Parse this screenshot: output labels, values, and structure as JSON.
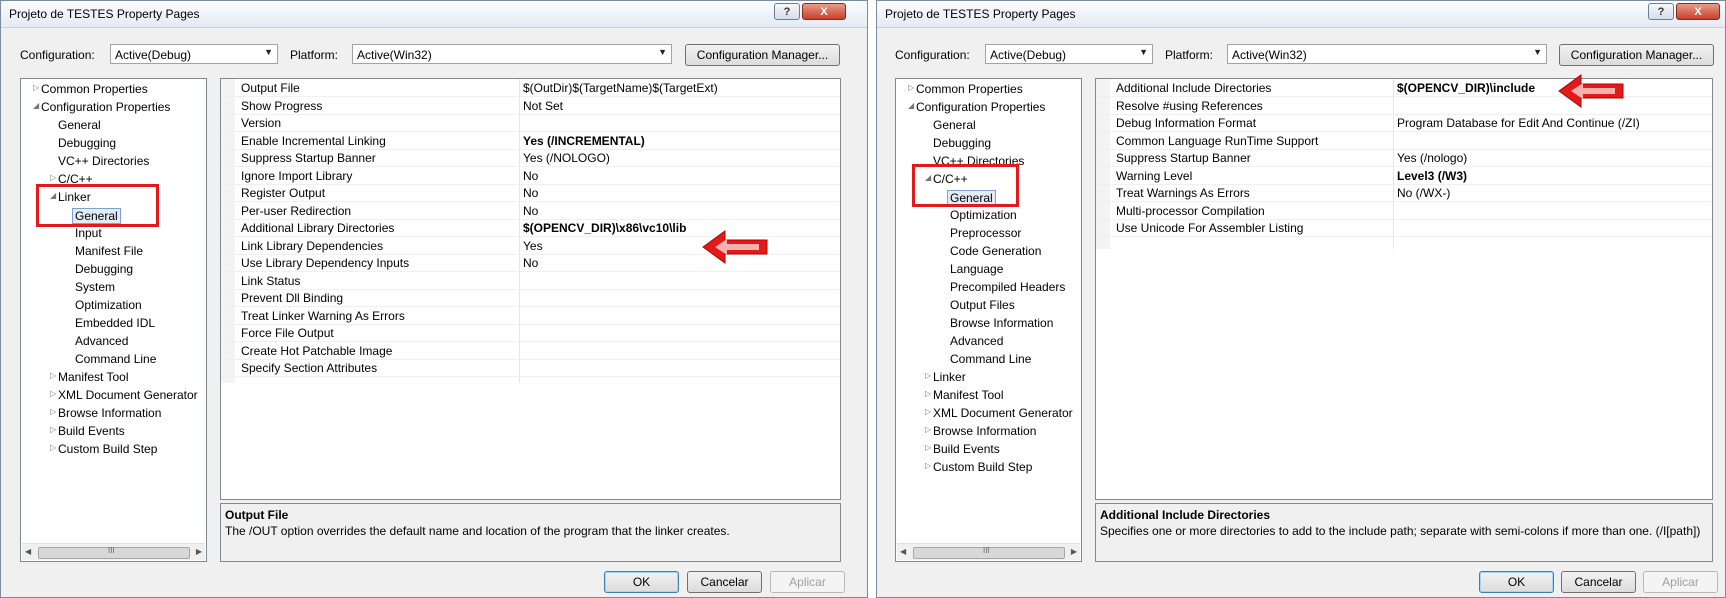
{
  "dialog_left": {
    "title": "Projeto de TESTES Property Pages",
    "help_glyph": "?",
    "close_glyph": "X",
    "config_label": "Configuration:",
    "config_value": "Active(Debug)",
    "platform_label": "Platform:",
    "platform_value": "Active(Win32)",
    "config_manager": "Configuration Manager...",
    "tree": [
      {
        "label": "Common Properties",
        "toggle": "▷"
      },
      {
        "label": "Configuration Properties",
        "toggle": "◢"
      },
      {
        "label": "General",
        "toggle": ""
      },
      {
        "label": "Debugging",
        "toggle": ""
      },
      {
        "label": "VC++ Directories",
        "toggle": ""
      },
      {
        "label": "C/C++",
        "toggle": "▷"
      },
      {
        "label": "Linker",
        "toggle": "◢"
      },
      {
        "label": "General",
        "toggle": ""
      },
      {
        "label": "Input",
        "toggle": ""
      },
      {
        "label": "Manifest File",
        "toggle": ""
      },
      {
        "label": "Debugging",
        "toggle": ""
      },
      {
        "label": "System",
        "toggle": ""
      },
      {
        "label": "Optimization",
        "toggle": ""
      },
      {
        "label": "Embedded IDL",
        "toggle": ""
      },
      {
        "label": "Advanced",
        "toggle": ""
      },
      {
        "label": "Command Line",
        "toggle": ""
      },
      {
        "label": "Manifest Tool",
        "toggle": "▷"
      },
      {
        "label": "XML Document Generator",
        "toggle": "▷"
      },
      {
        "label": "Browse Information",
        "toggle": "▷"
      },
      {
        "label": "Build Events",
        "toggle": "▷"
      },
      {
        "label": "Custom Build Step",
        "toggle": "▷"
      }
    ],
    "scroll_left": "◀",
    "scroll_right": "▶",
    "scroll_grip": "III",
    "props": [
      {
        "name": "Output File",
        "value": "$(OutDir)$(TargetName)$(TargetExt)"
      },
      {
        "name": "Show Progress",
        "value": "Not Set"
      },
      {
        "name": "Version",
        "value": ""
      },
      {
        "name": "Enable Incremental Linking",
        "value": "Yes (/INCREMENTAL)"
      },
      {
        "name": "Suppress Startup Banner",
        "value": "Yes (/NOLOGO)"
      },
      {
        "name": "Ignore Import Library",
        "value": "No"
      },
      {
        "name": "Register Output",
        "value": "No"
      },
      {
        "name": "Per-user Redirection",
        "value": "No"
      },
      {
        "name": "Additional Library Directories",
        "value": "$(OPENCV_DIR)\\x86\\vc10\\lib"
      },
      {
        "name": "Link Library Dependencies",
        "value": "Yes"
      },
      {
        "name": "Use Library Dependency Inputs",
        "value": "No"
      },
      {
        "name": "Link Status",
        "value": ""
      },
      {
        "name": "Prevent Dll Binding",
        "value": ""
      },
      {
        "name": "Treat Linker Warning As Errors",
        "value": ""
      },
      {
        "name": "Force File Output",
        "value": ""
      },
      {
        "name": "Create Hot Patchable Image",
        "value": ""
      },
      {
        "name": "Specify Section Attributes",
        "value": ""
      }
    ],
    "desc_title": "Output File",
    "desc_text": "The /OUT option overrides the default name and location of the program that the linker creates.",
    "ok": "OK",
    "cancel": "Cancelar",
    "apply": "Aplicar"
  },
  "dialog_right": {
    "title": "Projeto de TESTES Property Pages",
    "help_glyph": "?",
    "close_glyph": "X",
    "config_label": "Configuration:",
    "config_value": "Active(Debug)",
    "platform_label": "Platform:",
    "platform_value": "Active(Win32)",
    "config_manager": "Configuration Manager...",
    "tree": [
      {
        "label": "Common Properties",
        "toggle": "▷"
      },
      {
        "label": "Configuration Properties",
        "toggle": "◢"
      },
      {
        "label": "General",
        "toggle": ""
      },
      {
        "label": "Debugging",
        "toggle": ""
      },
      {
        "label": "VC++ Directories",
        "toggle": ""
      },
      {
        "label": "C/C++",
        "toggle": "◢"
      },
      {
        "label": "General",
        "toggle": ""
      },
      {
        "label": "Optimization",
        "toggle": ""
      },
      {
        "label": "Preprocessor",
        "toggle": ""
      },
      {
        "label": "Code Generation",
        "toggle": ""
      },
      {
        "label": "Language",
        "toggle": ""
      },
      {
        "label": "Precompiled Headers",
        "toggle": ""
      },
      {
        "label": "Output Files",
        "toggle": ""
      },
      {
        "label": "Browse Information",
        "toggle": ""
      },
      {
        "label": "Advanced",
        "toggle": ""
      },
      {
        "label": "Command Line",
        "toggle": ""
      },
      {
        "label": "Linker",
        "toggle": "▷"
      },
      {
        "label": "Manifest Tool",
        "toggle": "▷"
      },
      {
        "label": "XML Document Generator",
        "toggle": "▷"
      },
      {
        "label": "Browse Information",
        "toggle": "▷"
      },
      {
        "label": "Build Events",
        "toggle": "▷"
      },
      {
        "label": "Custom Build Step",
        "toggle": "▷"
      }
    ],
    "scroll_left": "◀",
    "scroll_right": "▶",
    "scroll_grip": "III",
    "props": [
      {
        "name": "Additional Include Directories",
        "value": "$(OPENCV_DIR)\\include"
      },
      {
        "name": "Resolve #using References",
        "value": ""
      },
      {
        "name": "Debug Information Format",
        "value": "Program Database for Edit And Continue (/ZI)"
      },
      {
        "name": "Common Language RunTime Support",
        "value": ""
      },
      {
        "name": "Suppress Startup Banner",
        "value": "Yes (/nologo)"
      },
      {
        "name": "Warning Level",
        "value": "Level3 (/W3)"
      },
      {
        "name": "Treat Warnings As Errors",
        "value": "No (/WX-)"
      },
      {
        "name": "Multi-processor Compilation",
        "value": ""
      },
      {
        "name": "Use Unicode For Assembler Listing",
        "value": ""
      }
    ],
    "desc_title": "Additional Include Directories",
    "desc_text": "Specifies one or more directories to add to the include path; separate with semi-colons if more than one. (/I[path])",
    "ok": "OK",
    "cancel": "Cancelar",
    "apply": "Aplicar"
  },
  "colors": {
    "highlight_red": "#e21a1a",
    "selection_fill": "#e2ecf8",
    "selection_border": "#7da2ce"
  }
}
